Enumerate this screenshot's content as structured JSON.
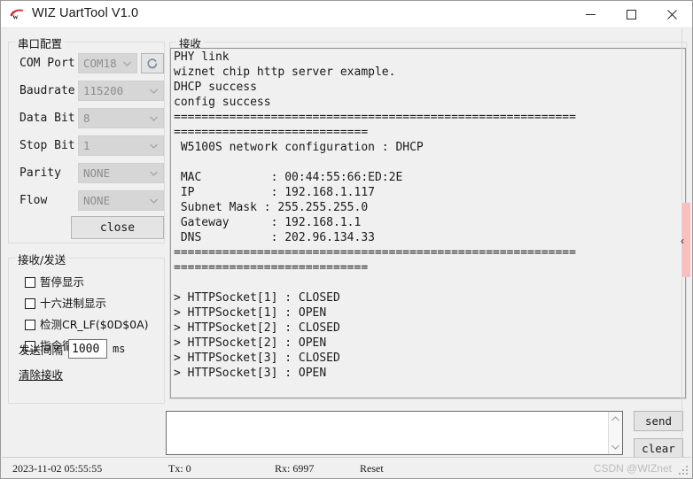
{
  "window": {
    "title": "WIZ UartTool V1.0",
    "icon": "wiznet-logo-icon",
    "minimize_label": "—",
    "maximize_label": "□",
    "close_label": "✕"
  },
  "serial_config": {
    "group_title": "串口配置",
    "rows": [
      {
        "label": "COM Port",
        "value": "COM18"
      },
      {
        "label": "Baudrate",
        "value": "115200"
      },
      {
        "label": "Data Bit",
        "value": "8"
      },
      {
        "label": "Stop Bit",
        "value": "1"
      },
      {
        "label": "Parity",
        "value": "NONE"
      },
      {
        "label": "Flow",
        "value": "NONE"
      }
    ],
    "refresh_icon": "refresh-icon",
    "close_button": "close"
  },
  "rxtx_panel": {
    "group_title": "接收/发送",
    "checkboxes": [
      {
        "label": "暂停显示",
        "checked": false
      },
      {
        "label": "十六进制显示",
        "checked": false
      },
      {
        "label": "检测CR_LF($0D$0A)",
        "checked": false
      },
      {
        "label": "指令循环发送",
        "checked": false
      }
    ],
    "interval_label": "发送间隔",
    "interval_value": "1000",
    "interval_unit": "ms",
    "clear_receive_link": "清除接收"
  },
  "receive": {
    "group_title": "接收",
    "text": "PHY link\nwiznet chip http server example.\nDHCP success\nconfig success\n==========================================================\n============================\n W5100S network configuration : DHCP\n\n MAC          : 00:44:55:66:ED:2E\n IP           : 192.168.1.117\n Subnet Mask : 255.255.255.0\n Gateway      : 192.168.1.1\n DNS          : 202.96.134.33\n==========================================================\n============================\n\n> HTTPSocket[1] : CLOSED\n> HTTPSocket[1] : OPEN\n> HTTPSocket[2] : CLOSED\n> HTTPSocket[2] : OPEN\n> HTTPSocket[3] : CLOSED\n> HTTPSocket[3] : OPEN"
  },
  "send_area": {
    "value": "",
    "placeholder": "",
    "scroll_up_icon": "chevron-up-icon",
    "scroll_down_icon": "chevron-down-icon",
    "send_button": "send",
    "clear_button": "clear"
  },
  "statusbar": {
    "timestamp": "2023-11-02 05:55:55",
    "tx": "Tx: 0",
    "rx": "Rx: 6997",
    "reset": "Reset",
    "watermark": "CSDN @WIZnet"
  },
  "edge": {
    "chevron": "‹",
    "marker_color": "#fcbdbd"
  }
}
